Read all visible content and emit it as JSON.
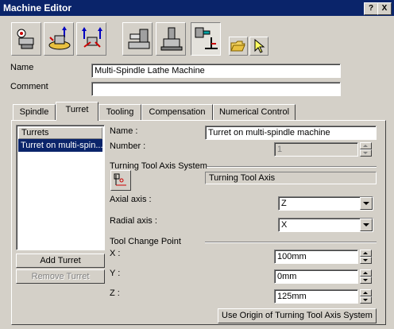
{
  "window": {
    "title": "Machine Editor",
    "help_label": "?",
    "close_label": "X"
  },
  "toolbar": {
    "buttons": [
      {
        "icon": "machine-select-icon"
      },
      {
        "icon": "turning-machine-icon"
      },
      {
        "icon": "multi-slide-machine-icon"
      },
      {
        "icon": "spindle-machine-icon"
      },
      {
        "icon": "vertical-lathe-icon"
      },
      {
        "icon": "multi-spindle-lathe-icon"
      },
      {
        "icon": "open-folder-icon"
      },
      {
        "icon": "select-arrow-icon"
      }
    ]
  },
  "form": {
    "name_label": "Name",
    "name_value": "Multi-Spindle Lathe Machine",
    "comment_label": "Comment",
    "comment_value": ""
  },
  "tabs": [
    {
      "label": "Spindle"
    },
    {
      "label": "Turret"
    },
    {
      "label": "Tooling"
    },
    {
      "label": "Compensation"
    },
    {
      "label": "Numerical Control"
    }
  ],
  "turrets": {
    "header": "Turrets",
    "items": [
      "Turret on multi-spin..."
    ],
    "add_label": "Add Turret",
    "remove_label": "Remove Turret"
  },
  "turret": {
    "name_label": "Name :",
    "name_value": "Turret on multi-spindle machine",
    "number_label": "Number :",
    "number_value": "1",
    "axis_system_label": "Turning Tool Axis System",
    "axis_system_value": "Turning Tool Axis",
    "axial_label": "Axial axis :",
    "axial_value": "Z",
    "radial_label": "Radial axis :",
    "radial_value": "X",
    "tool_change_label": "Tool Change Point",
    "x_label": "X :",
    "x_value": "100mm",
    "y_label": "Y :",
    "y_value": "0mm",
    "z_label": "Z :",
    "z_value": "125mm",
    "use_origin_label": "Use Origin of Turning Tool Axis System"
  },
  "colors": {
    "title_bar": "#0a246a",
    "dialog_bg": "#d4d0c8",
    "selection": "#0a246a"
  }
}
